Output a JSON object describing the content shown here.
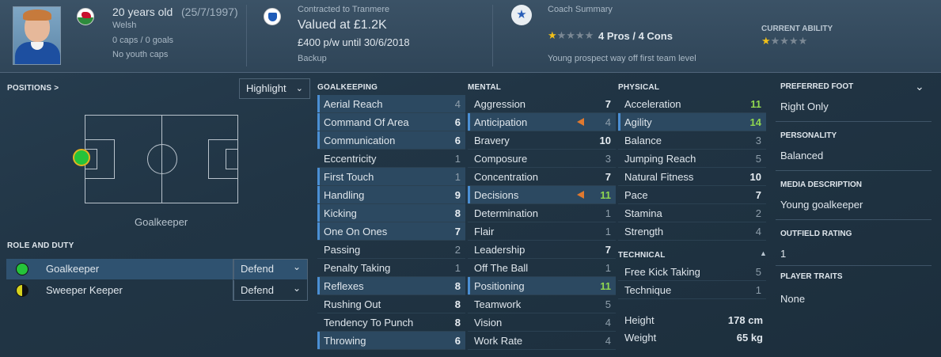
{
  "header": {
    "age": "20 years old",
    "dob": "(25/7/1997)",
    "nationality": "Welsh",
    "caps": "0 caps / 0 goals",
    "youth_caps": "No youth caps",
    "contract_label": "Contracted to Tranmere",
    "value": "Valued at £1.2K",
    "wage": "£400 p/w until 30/6/2018",
    "squad_status": "Backup",
    "coach_label": "Coach Summary",
    "pros_cons": "4 Pros / 4 Cons",
    "coach_desc": "Young prospect way off first team level",
    "current_ability_label": "CURRENT ABILITY",
    "potential_stars": {
      "on": 1,
      "off": 4
    },
    "current_stars": {
      "on": 1,
      "off": 4
    }
  },
  "positions": {
    "label": "POSITIONS >",
    "highlight": "Highlight",
    "position_name": "Goalkeeper"
  },
  "role_duty": {
    "label": "ROLE AND DUTY",
    "roles": [
      {
        "name": "Goalkeeper",
        "duty": "Defend",
        "color": "#25c33a"
      },
      {
        "name": "Sweeper Keeper",
        "duty": "Defend",
        "color": "#d6d21d"
      }
    ]
  },
  "goalkeeping": {
    "label": "GOALKEEPING",
    "attrs": [
      {
        "name": "Aerial Reach",
        "value": "4"
      },
      {
        "name": "Command Of Area",
        "value": "6"
      },
      {
        "name": "Communication",
        "value": "6"
      },
      {
        "name": "Eccentricity",
        "value": "1"
      },
      {
        "name": "First Touch",
        "value": "1"
      },
      {
        "name": "Handling",
        "value": "9"
      },
      {
        "name": "Kicking",
        "value": "8"
      },
      {
        "name": "One On Ones",
        "value": "7"
      },
      {
        "name": "Passing",
        "value": "2"
      },
      {
        "name": "Penalty Taking",
        "value": "1"
      },
      {
        "name": "Reflexes",
        "value": "8"
      },
      {
        "name": "Rushing Out",
        "value": "8"
      },
      {
        "name": "Tendency To Punch",
        "value": "8"
      },
      {
        "name": "Throwing",
        "value": "6"
      }
    ]
  },
  "mental": {
    "label": "MENTAL",
    "attrs": [
      {
        "name": "Aggression",
        "value": "7"
      },
      {
        "name": "Anticipation",
        "value": "4"
      },
      {
        "name": "Bravery",
        "value": "10"
      },
      {
        "name": "Composure",
        "value": "3"
      },
      {
        "name": "Concentration",
        "value": "7"
      },
      {
        "name": "Decisions",
        "value": "11"
      },
      {
        "name": "Determination",
        "value": "1"
      },
      {
        "name": "Flair",
        "value": "1"
      },
      {
        "name": "Leadership",
        "value": "7"
      },
      {
        "name": "Off The Ball",
        "value": "1"
      },
      {
        "name": "Positioning",
        "value": "11"
      },
      {
        "name": "Teamwork",
        "value": "5"
      },
      {
        "name": "Vision",
        "value": "4"
      },
      {
        "name": "Work Rate",
        "value": "4"
      }
    ]
  },
  "physical": {
    "label": "PHYSICAL",
    "attrs": [
      {
        "name": "Acceleration",
        "value": "11"
      },
      {
        "name": "Agility",
        "value": "14"
      },
      {
        "name": "Balance",
        "value": "3"
      },
      {
        "name": "Jumping Reach",
        "value": "5"
      },
      {
        "name": "Natural Fitness",
        "value": "10"
      },
      {
        "name": "Pace",
        "value": "7"
      },
      {
        "name": "Stamina",
        "value": "2"
      },
      {
        "name": "Strength",
        "value": "4"
      }
    ]
  },
  "technical": {
    "label": "TECHNICAL",
    "attrs": [
      {
        "name": "Free Kick Taking",
        "value": "5"
      },
      {
        "name": "Technique",
        "value": "1"
      }
    ]
  },
  "body": {
    "height_label": "Height",
    "height": "178 cm",
    "weight_label": "Weight",
    "weight": "65 kg"
  },
  "info": {
    "preferred_foot_label": "PREFERRED FOOT",
    "preferred_foot": "Right Only",
    "personality_label": "PERSONALITY",
    "personality": "Balanced",
    "media_label": "MEDIA DESCRIPTION",
    "media": "Young goalkeeper",
    "outfield_label": "OUTFIELD RATING",
    "outfield": "1",
    "traits_label": "PLAYER TRAITS",
    "traits": "None"
  },
  "colors": {
    "accent": "#4b8fd4",
    "good": "#8fd650",
    "star": "#f2c019",
    "flag": "#e0792f"
  }
}
